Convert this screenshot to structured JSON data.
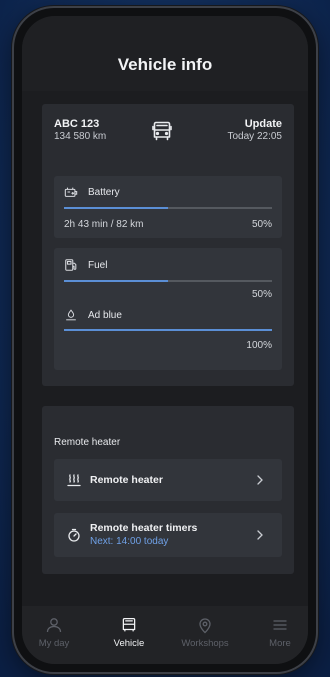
{
  "header": {
    "title": "Vehicle info"
  },
  "vehicle": {
    "plate": "ABC 123",
    "odometer": "134 580 km",
    "update_label": "Update",
    "update_time": "Today 22:05",
    "icon": "bus-front-icon"
  },
  "battery": {
    "label": "Battery",
    "range": "2h 43 min / 82 km",
    "percent_text": "50%",
    "level": 0.5
  },
  "fuel": {
    "label": "Fuel",
    "percent_text": "50%",
    "level": 0.5
  },
  "adblue": {
    "label": "Ad blue",
    "percent_text": "100%",
    "level": 1.0
  },
  "remote_heater": {
    "section_title": "Remote heater",
    "items": [
      {
        "label": "Remote heater",
        "icon": "heater-icon"
      },
      {
        "label": "Remote heater timers",
        "sublabel": "Next: 14:00 today",
        "icon": "timer-icon"
      }
    ]
  },
  "tabs": [
    {
      "label": "My day",
      "icon": "person-icon",
      "active": false
    },
    {
      "label": "Vehicle",
      "icon": "bus-front-icon",
      "active": true
    },
    {
      "label": "Workshops",
      "icon": "location-pin-icon",
      "active": false
    },
    {
      "label": "More",
      "icon": "menu-icon",
      "active": false
    }
  ],
  "colors": {
    "accent": "#5b8fd6",
    "link": "#6fa0e6",
    "background": "#1c1d20",
    "card": "#2a2c31"
  }
}
